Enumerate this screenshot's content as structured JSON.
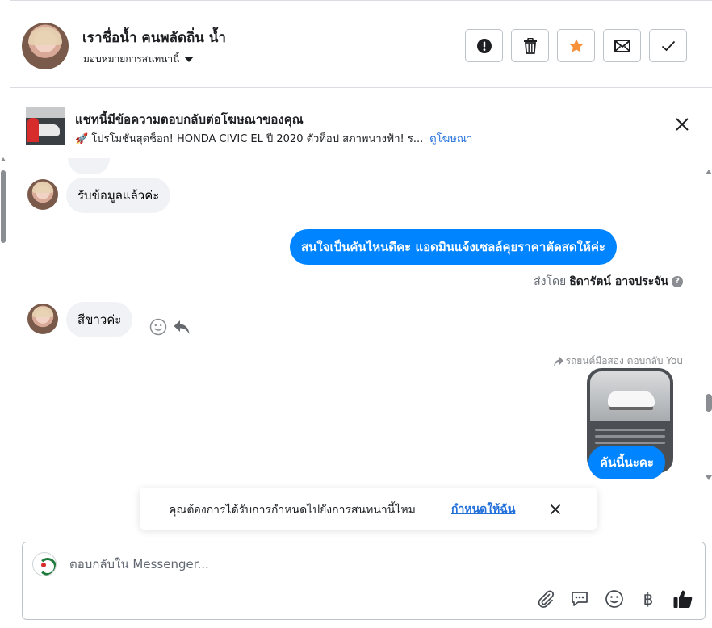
{
  "header": {
    "contact_name": "เราชื่อน้ำ คนพลัดถิ่น น้ำ",
    "assign_label": "มอบหมายการสนทนานี้",
    "buttons": [
      {
        "name": "report-button",
        "icon": "exclamation-icon"
      },
      {
        "name": "delete-button",
        "icon": "trash-icon"
      },
      {
        "name": "star-button",
        "icon": "star-icon",
        "color": "#f7923b"
      },
      {
        "name": "mark-unread-button",
        "icon": "envelope-icon"
      },
      {
        "name": "mark-done-button",
        "icon": "check-icon"
      }
    ]
  },
  "ad_banner": {
    "title": "แชทนี้มีข้อความตอบกลับต่อโฆษณาของคุณ",
    "description": "🚀 โปรโมชั่นสุดช็อก! HONDA CIVIC EL ปี 2020 ตัวท็อป สภาพนางฟ้า! ร...",
    "link": "ดูโฆษณา"
  },
  "messages": {
    "m1_text": "รับข้อมูลแล้วค่ะ",
    "m2_text": "สนใจเป็นคันไหนดีคะ แอดมินแจ้งเซลล์คุยราคาตัดสดให้ค่ะ",
    "sent_by_prefix": "ส่งโดย",
    "sent_by_name": "ธิดารัตน์ อาจประจัน",
    "help": "?",
    "m3_text": "สีขาวค่ะ",
    "replied_label": "รถยนต์มือสอง ตอบกลับ You",
    "m4_text": "คันนี้นะคะ"
  },
  "toast": {
    "text": "คุณต้องการได้รับการกำหนดไปยังการสนทนานี้ไหม",
    "link": "กำหนดให้ฉัน"
  },
  "composer": {
    "placeholder": "ตอบกลับใน Messenger...",
    "currency_symbol": "฿"
  },
  "colors": {
    "accent": "#0084ff",
    "link": "#216fdb",
    "star": "#f7923b"
  }
}
